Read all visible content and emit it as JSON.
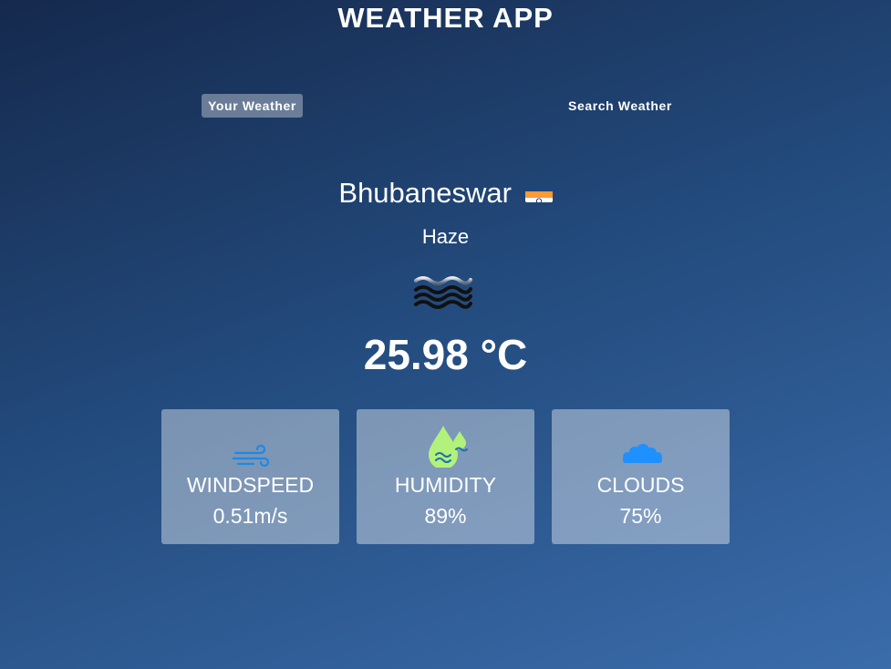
{
  "app": {
    "title": "WEATHER APP"
  },
  "tabs": [
    {
      "label": "Your Weather",
      "active": true
    },
    {
      "label": "Search Weather",
      "active": false
    }
  ],
  "weather": {
    "city": "Bhubaneswar",
    "country_flag_icon": "india-flag-icon",
    "condition": "Haze",
    "condition_icon": "haze-icon",
    "temperature": "25.98 °C"
  },
  "stats": [
    {
      "label": "WINDSPEED",
      "value": "0.51m/s",
      "icon": "wind-icon",
      "icon_color": "#1e88e5"
    },
    {
      "label": "HUMIDITY",
      "value": "89%",
      "icon": "humidity-icon",
      "icon_color": "#b2f27a"
    },
    {
      "label": "CLOUDS",
      "value": "75%",
      "icon": "cloud-icon",
      "icon_color": "#1e90ff"
    }
  ]
}
